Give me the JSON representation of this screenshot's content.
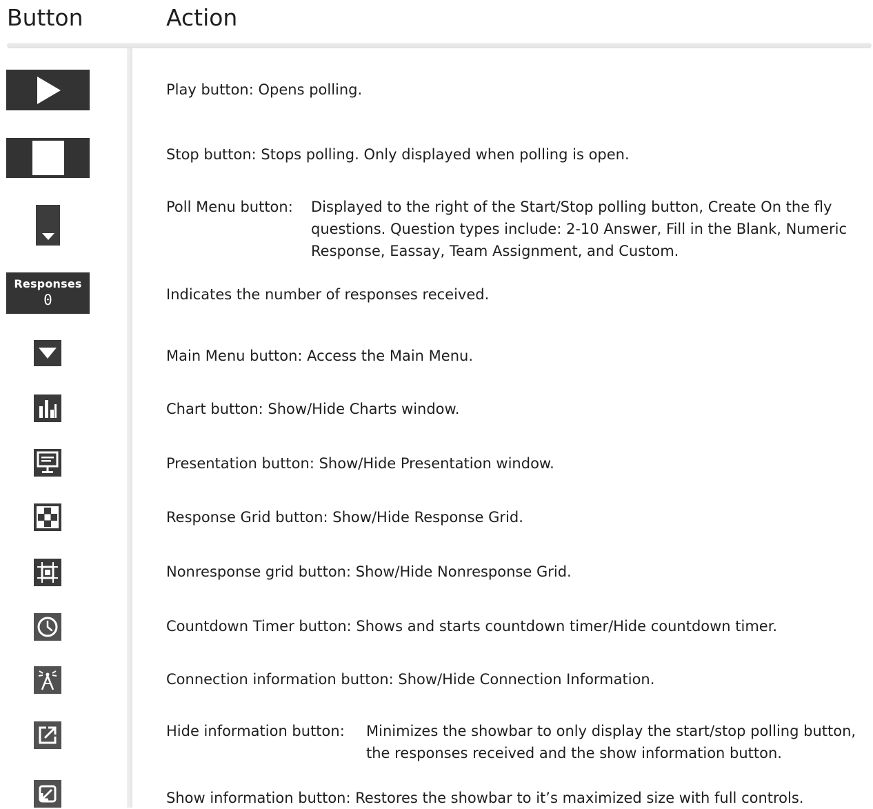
{
  "headers": {
    "button": "Button",
    "action": "Action"
  },
  "icons": {
    "play": "play-icon",
    "stop": "stop-icon",
    "poll_menu": "caret-down-icon",
    "main_menu": "triangle-down-icon",
    "chart": "bar-chart-icon",
    "presentation": "presentation-icon",
    "response_grid": "checkerboard-icon",
    "nonresponse_grid": "crop-frame-icon",
    "countdown_timer": "clock-icon",
    "connection_info": "antenna-icon",
    "hide_info": "external-link-icon",
    "show_info": "restore-icon"
  },
  "responses_widget": {
    "label": "Responses",
    "count": "0"
  },
  "rows": {
    "play": "Play button:  Opens polling.",
    "stop": "Stop button:  Stops polling. Only displayed when polling is open.",
    "poll_menu_label": "Poll Menu button:",
    "poll_menu_text": "Displayed to the right of the Start/Stop polling button, Create On the fly questions.  Question types include: 2-10 Answer, Fill in the Blank, Numeric Response, Eassay, Team Assignment, and Custom.",
    "responses": "Indicates the number of responses received.",
    "main_menu": "Main Menu button:  Access the Main Menu.",
    "chart": "Chart button:  Show/Hide Charts window.",
    "presentation": "Presentation button:  Show/Hide Presentation window.",
    "response_grid": "Response Grid button:  Show/Hide Response Grid.",
    "nonresponse_grid": "Nonresponse grid button:  Show/Hide Nonresponse Grid.",
    "countdown_timer": "Countdown Timer button:  Shows and starts countdown timer/Hide countdown timer.",
    "connection_info": "Connection information button:  Show/Hide Connection Information.",
    "hide_info_label": "Hide information button:",
    "hide_info_text": "Minimizes the showbar to only display the start/stop polling button, the responses received and the show information button.",
    "show_info": "Show information button:  Restores the showbar to it’s maximized size with full controls."
  },
  "colors": {
    "button_bg": "#333333",
    "icon_bg": "#3a3a3a",
    "icon_gray_bg": "#515151",
    "glyph": "#ffffff",
    "text": "#1f1f1f",
    "rule": "#e6e6e6"
  }
}
